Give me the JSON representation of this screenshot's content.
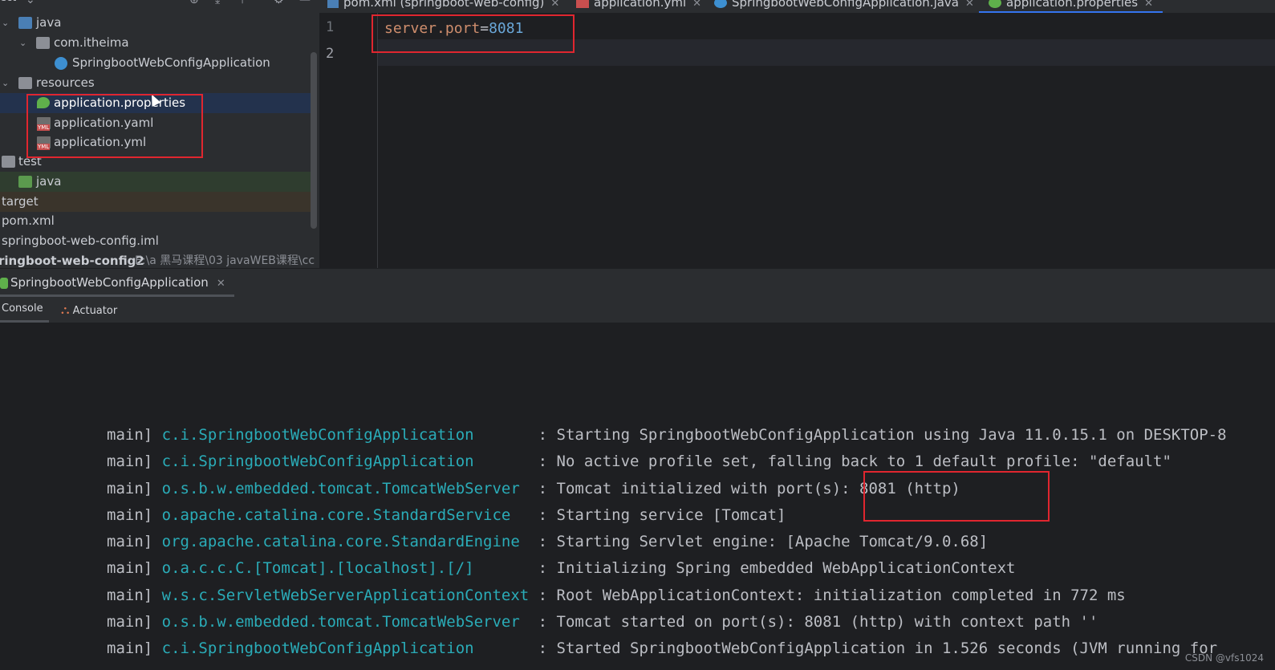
{
  "project_panel": {
    "header_label": "ect",
    "items": [
      {
        "label": "java"
      },
      {
        "label": "com.itheima"
      },
      {
        "label": "SpringbootWebConfigApplication"
      },
      {
        "label": "resources"
      },
      {
        "label": "application.properties"
      },
      {
        "label": "application.yaml"
      },
      {
        "label": "application.yml"
      },
      {
        "label": "test"
      },
      {
        "label": "java"
      },
      {
        "label": "target"
      },
      {
        "label": "pom.xml"
      },
      {
        "label": "springboot-web-config.iml"
      },
      {
        "label": "ringboot-web-config2",
        "path": "E:\\a  黑马课程\\03  javaWEB课程\\cc"
      }
    ]
  },
  "editor": {
    "tabs": [
      {
        "label": "pom.xml (springboot-web-config)"
      },
      {
        "label": "application.yml"
      },
      {
        "label": "SpringbootWebConfigApplication.java"
      },
      {
        "label": "application.properties"
      }
    ],
    "line_numbers": [
      "1",
      "2"
    ],
    "code": {
      "key": "server.port",
      "eq": "=",
      "value": "8081"
    }
  },
  "run_window": {
    "tab_label": "SpringbootWebConfigApplication",
    "subtabs": [
      {
        "label": "Console"
      },
      {
        "label": "Actuator"
      }
    ],
    "console_lines": [
      {
        "thread": "main] ",
        "logger": "c.i.SpringbootWebConfigApplication      ",
        "message": " : Starting SpringbootWebConfigApplication using Java 11.0.15.1 on DESKTOP-8"
      },
      {
        "thread": "main] ",
        "logger": "c.i.SpringbootWebConfigApplication      ",
        "message": " : No active profile set, falling back to 1 default profile: \"default\""
      },
      {
        "thread": "main] ",
        "logger": "o.s.b.w.embedded.tomcat.TomcatWebServer ",
        "message": " : Tomcat initialized with port(s): 8081 (http)"
      },
      {
        "thread": "main] ",
        "logger": "o.apache.catalina.core.StandardService  ",
        "message": " : Starting service [Tomcat]"
      },
      {
        "thread": "main] ",
        "logger": "org.apache.catalina.core.StandardEngine ",
        "message": " : Starting Servlet engine: [Apache Tomcat/9.0.68]"
      },
      {
        "thread": "main] ",
        "logger": "o.a.c.c.C.[Tomcat].[localhost].[/]      ",
        "message": " : Initializing Spring embedded WebApplicationContext"
      },
      {
        "thread": "main] ",
        "logger": "w.s.c.ServletWebServerApplicationContext",
        "message": " : Root WebApplicationContext: initialization completed in 772 ms"
      },
      {
        "thread": "main] ",
        "logger": "o.s.b.w.embedded.tomcat.TomcatWebServer ",
        "message": " : Tomcat started on port(s): 8081 (http) with context path ''"
      },
      {
        "thread": "main] ",
        "logger": "c.i.SpringbootWebConfigApplication      ",
        "message": " : Started SpringbootWebConfigApplication in 1.526 seconds (JVM running for"
      }
    ],
    "watermark": "CSDN @vfs1024"
  },
  "colors": {
    "highlight_box": "#e0262f",
    "accent_tab": "#3574f0",
    "logger": "#2aacb8",
    "key": "#cf8e6d",
    "number": "#6aa7d8"
  }
}
